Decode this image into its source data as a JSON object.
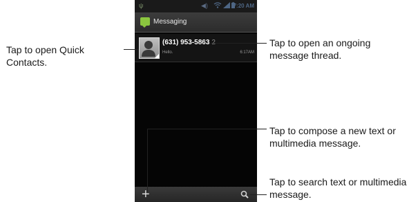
{
  "status_bar": {
    "time": "7:20 AM"
  },
  "app": {
    "title": "Messaging"
  },
  "thread": {
    "sender": "(631) 953-5863",
    "count": "2",
    "preview": "Hello.",
    "time": "6:17AM"
  },
  "callouts": {
    "quick_contacts": "Tap to open Quick Contacts.",
    "open_thread": "Tap to open an ongoing message thread.",
    "compose": "Tap to compose a new text or multimedia message.",
    "search": "Tap to search text or multimedia message."
  },
  "icons": {
    "app": "messaging-icon",
    "avatar": "contact-avatar-icon",
    "compose": "plus-icon",
    "search": "search-icon"
  },
  "colors": {
    "screen_bg": "#050505",
    "app_icon": "#8bc63f",
    "status_icons": "#4e6684"
  }
}
